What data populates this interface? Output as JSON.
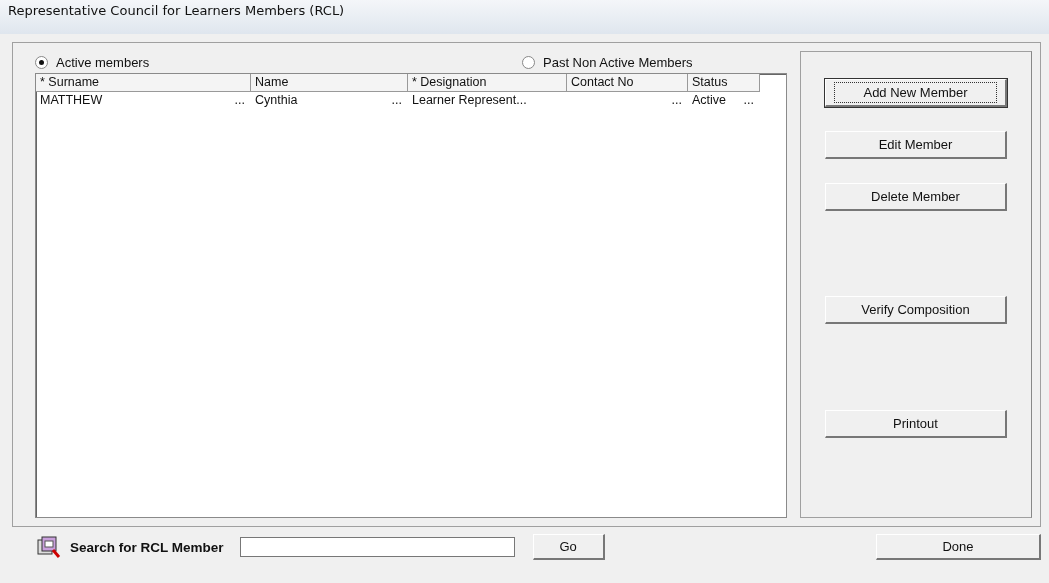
{
  "window": {
    "title": "Representative Council for Learners Members (RCL)"
  },
  "filters": [
    {
      "label": "Active members",
      "selected": true
    },
    {
      "label": "Past Non Active Members",
      "selected": false
    }
  ],
  "table": {
    "columns": [
      "* Surname",
      "Name",
      "* Designation",
      "Contact No",
      "Status"
    ],
    "rows": [
      {
        "selected": false,
        "cells": [
          {
            "text": "MATTHEW",
            "more": "..."
          },
          {
            "text": "Cynthia",
            "more": "..."
          },
          {
            "text": "Learner Represent..."
          },
          {
            "more": "..."
          },
          {
            "text": "Active",
            "more": "..."
          }
        ]
      }
    ]
  },
  "actions": [
    {
      "label": "Add New Member",
      "focused": true
    },
    {
      "label": "Edit Member",
      "focused": false
    },
    {
      "label": "Delete Member",
      "focused": false
    },
    {
      "label": "Verify Composition",
      "focused": false
    },
    {
      "label": "Printout",
      "focused": false
    }
  ],
  "search": {
    "label": "Search for RCL Member",
    "button": "Go"
  },
  "done": "Done"
}
